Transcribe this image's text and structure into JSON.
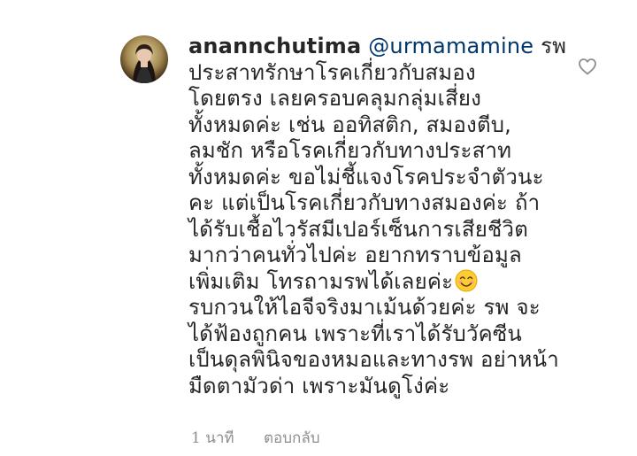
{
  "comment": {
    "username": "anannchutima",
    "mention": "@urmamamine",
    "first_line_rest": " รพ",
    "lines": [
      "ประสาทรักษาโรคเกี่ยวกับสมอง",
      "โดยตรง เลยครอบคลุมกลุ่มเสี่ยง",
      "ทั้งหมดค่ะ เช่น ออทิสติก, สมองตีบ,",
      "ลมชัก หรือโรคเกี่ยวกับทางประสาท",
      "ทั้งหมดค่ะ ขอไม่ชี้แจงโรคประจำตัวนะ",
      "คะ แต่เป็นโรคเกี่ยวกับทางสมองค่ะ ถ้า",
      "ได้รับเชื้อไวรัสมีเปอร์เซ็นการเสียชีวิต",
      "มากว่าคนทั่วไปค่ะ อยากทราบข้อมูล"
    ],
    "emoji_line": "เพิ่มเติม โทรถามรพได้เลยค่ะ",
    "lines_after": [
      "รบกวนให้ไอจีจริงมาเม้นด้วยค่ะ รพ จะ",
      "ได้ฟ้องถูกคน เพราะที่เราได้รับวัคซีน",
      "เป็นดุลพินิจของหมอและทางรพ อย่าหน้า",
      "มืดตามัวด่า เพราะมันดูโง่ค่ะ"
    ],
    "emoji_icon": "smiling-face-emoji",
    "timestamp": "1 นาที",
    "reply_label": "ตอบกลับ",
    "like_icon": "heart-outline-icon"
  },
  "colors": {
    "text": "#262626",
    "mention": "#00376b",
    "meta": "#8e8e8e"
  }
}
